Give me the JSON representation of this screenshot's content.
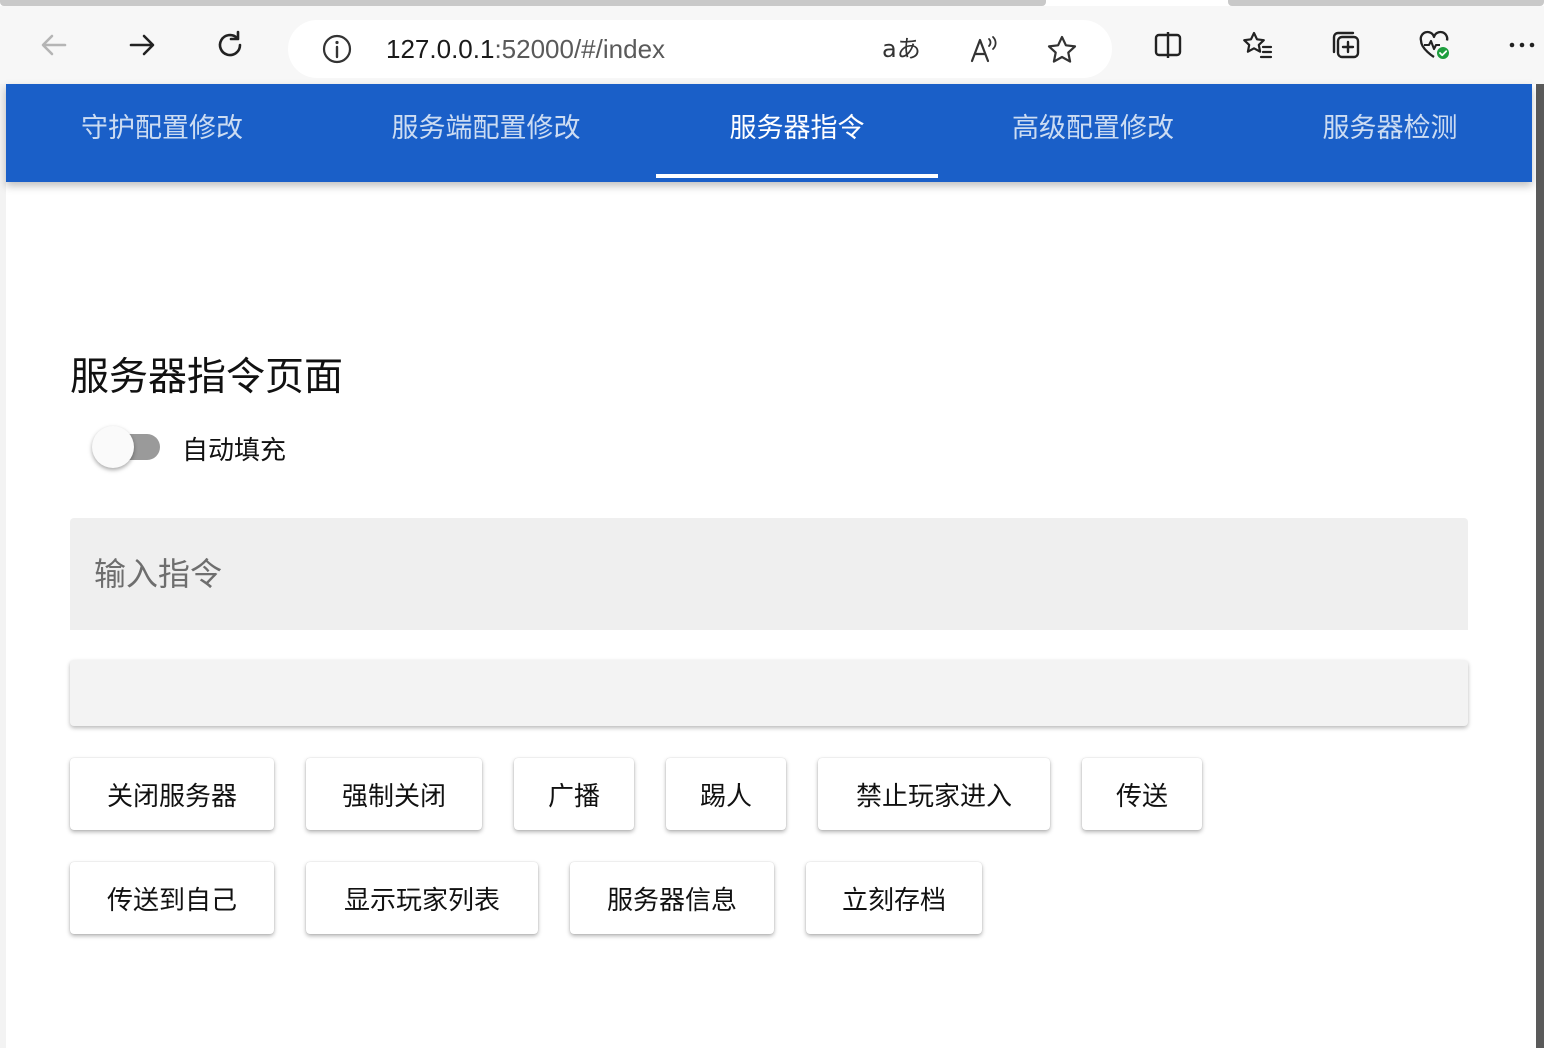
{
  "browser": {
    "url_host": "127.0.0.1",
    "url_rest": ":52000/#/index",
    "icons": [
      "back-icon",
      "forward-icon",
      "refresh-icon",
      "info-icon",
      "translate-icon",
      "read-aloud-icon",
      "favorite-star-icon",
      "split-screen-icon",
      "favorites-icon",
      "collections-icon",
      "browser-essentials-icon",
      "more-icon"
    ],
    "translate_label": "aあ"
  },
  "nav": {
    "tabs": [
      {
        "label": "守护配置修改"
      },
      {
        "label": "服务端配置修改"
      },
      {
        "label": "服务器指令"
      },
      {
        "label": "高级配置修改"
      },
      {
        "label": "服务器检测"
      }
    ],
    "active_index": 2,
    "color": "#1a5fc8"
  },
  "main": {
    "title": "服务器指令页面",
    "auto_fill": {
      "label": "自动填充",
      "on": false
    },
    "command_input": {
      "placeholder": "输入指令",
      "value": ""
    },
    "output": {
      "text": ""
    },
    "buttons_row1": [
      {
        "label": "关闭服务器"
      },
      {
        "label": "强制关闭"
      },
      {
        "label": "广播"
      },
      {
        "label": "踢人"
      },
      {
        "label": "禁止玩家进入"
      },
      {
        "label": "传送"
      }
    ],
    "buttons_row2": [
      {
        "label": "传送到自己"
      },
      {
        "label": "显示玩家列表"
      },
      {
        "label": "服务器信息"
      },
      {
        "label": "立刻存档"
      }
    ]
  }
}
